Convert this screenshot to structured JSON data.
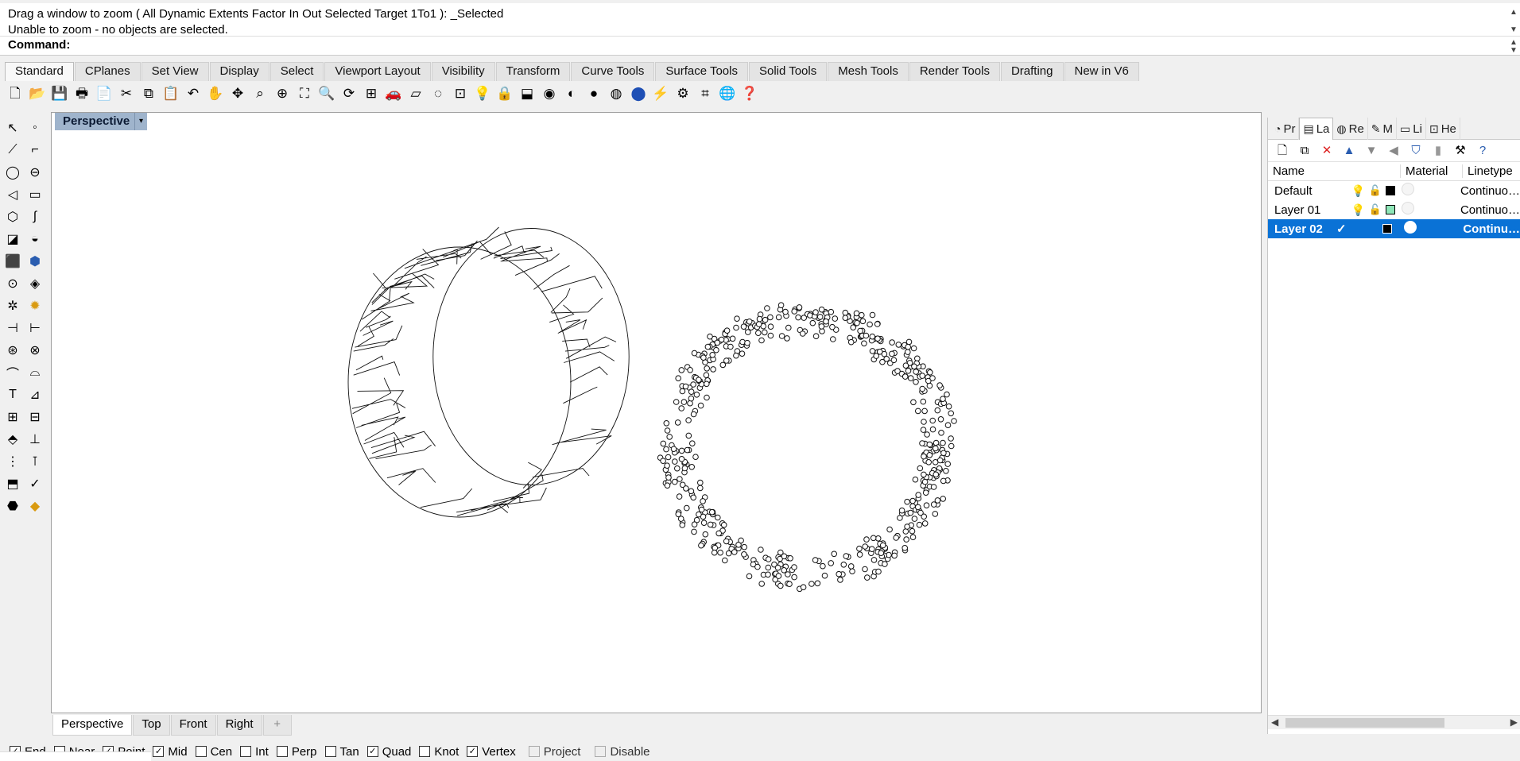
{
  "command": {
    "history_line1": "Drag a window to zoom ( All  Dynamic  Extents  Factor  In  Out  Selected  Target  1To1 ): _Selected",
    "history_line2": "Unable to zoom - no objects are selected.",
    "prompt": "Command:"
  },
  "toolbar_tabs": [
    "Standard",
    "CPlanes",
    "Set View",
    "Display",
    "Select",
    "Viewport Layout",
    "Visibility",
    "Transform",
    "Curve Tools",
    "Surface Tools",
    "Solid Tools",
    "Mesh Tools",
    "Render Tools",
    "Drafting",
    "New in V6"
  ],
  "standard_icons": [
    "new-file",
    "open",
    "save",
    "print",
    "import",
    "cut",
    "copy",
    "paste",
    "undo",
    "pan",
    "move",
    "zoom-window",
    "zoom-dynamic",
    "zoom-extents",
    "zoom-selected",
    "rotate-view",
    "four-viewports",
    "car",
    "layer",
    "lasso",
    "group",
    "light",
    "lock",
    "material",
    "color-wheel",
    "shade",
    "sphere",
    "rendered",
    "blue-sphere",
    "spotlight",
    "gear",
    "crop",
    "globe",
    "help"
  ],
  "viewport": {
    "title": "Perspective",
    "dropdown_icon": "▾"
  },
  "view_tabs": [
    "Perspective",
    "Top",
    "Front",
    "Right"
  ],
  "view_tab_add": "+",
  "snaps": [
    {
      "label": "End",
      "checked": true
    },
    {
      "label": "Near",
      "checked": false
    },
    {
      "label": "Point",
      "checked": true
    },
    {
      "label": "Mid",
      "checked": true
    },
    {
      "label": "Cen",
      "checked": false
    },
    {
      "label": "Int",
      "checked": false
    },
    {
      "label": "Perp",
      "checked": false
    },
    {
      "label": "Tan",
      "checked": false
    },
    {
      "label": "Quad",
      "checked": true
    },
    {
      "label": "Knot",
      "checked": false
    },
    {
      "label": "Vertex",
      "checked": true
    },
    {
      "label": "Project",
      "checked": false
    },
    {
      "label": "Disable",
      "checked": false
    }
  ],
  "panel": {
    "tabs": [
      {
        "label": "Pr",
        "icon": "properties-icon"
      },
      {
        "label": "La",
        "icon": "layers-icon"
      },
      {
        "label": "Re",
        "icon": "render-icon"
      },
      {
        "label": "M",
        "icon": "materials-icon"
      },
      {
        "label": "Li",
        "icon": "libraries-icon"
      },
      {
        "label": "He",
        "icon": "help-icon"
      }
    ],
    "columns": {
      "name": "Name",
      "material": "Material",
      "linetype": "Linetype"
    },
    "layers": [
      {
        "name": "Default",
        "color": "#000000",
        "linetype": "Continuo…",
        "current": false,
        "selected": false
      },
      {
        "name": "Layer 01",
        "color": "#8ee6b8",
        "linetype": "Continuo…",
        "current": false,
        "selected": false
      },
      {
        "name": "Layer 02",
        "color": "#000000",
        "linetype": "Continu…",
        "current": true,
        "selected": true
      }
    ],
    "current_mark": "✓"
  },
  "colors": {
    "accent": "#0a72d6",
    "viewport_title_bg": "#9fb4cc"
  }
}
